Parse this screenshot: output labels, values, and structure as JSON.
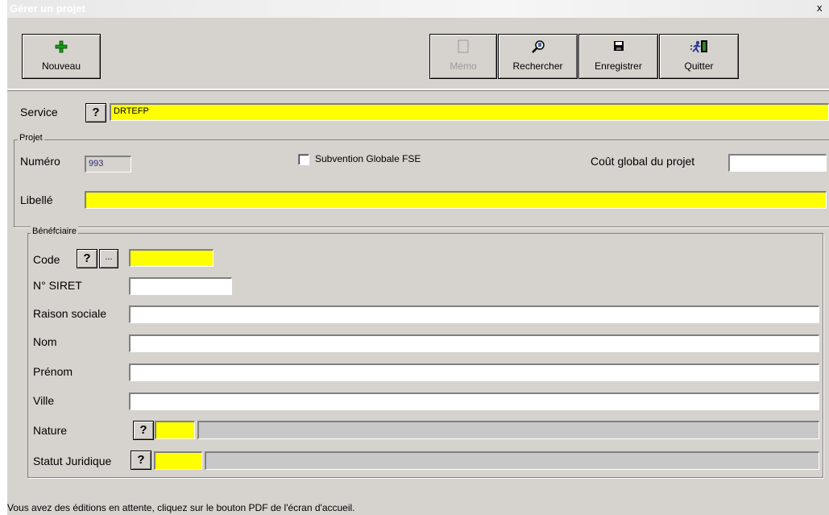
{
  "window": {
    "title": "Gérer un projet",
    "close_glyph": "x"
  },
  "toolbar": {
    "nouveau": {
      "label": "Nouveau",
      "icon": "plus-icon"
    },
    "memo": {
      "label": "Mémo",
      "icon": "memo-icon",
      "disabled": true
    },
    "rechercher": {
      "label": "Rechercher",
      "icon": "search-icon"
    },
    "enregistrer": {
      "label": "Enregistrer",
      "icon": "save-icon"
    },
    "quitter": {
      "label": "Quitter",
      "icon": "exit-icon"
    }
  },
  "service": {
    "label": "Service",
    "help": "?",
    "value": "DRTEFP"
  },
  "projet": {
    "legend": "Projet",
    "numero_label": "Numéro",
    "numero_value": "993",
    "subvention_label": "Subvention Globale FSE",
    "subvention_checked": false,
    "cout_label": "Coût global du projet",
    "cout_value": "",
    "libelle_label": "Libellé",
    "libelle_value": ""
  },
  "beneficiaire": {
    "legend": "Bénéfciaire",
    "code_label": "Code",
    "code_help": "?",
    "code_browse": "...",
    "code_value": "",
    "siret_label": "N° SIRET",
    "siret_value": "",
    "raison_label": "Raison sociale",
    "raison_value": "",
    "nom_label": "Nom",
    "nom_value": "",
    "prenom_label": "Prénom",
    "prenom_value": "",
    "ville_label": "Ville",
    "ville_value": "",
    "nature_label": "Nature",
    "nature_help": "?",
    "nature_code": "",
    "nature_desc": "",
    "statut_label": "Statut Juridique",
    "statut_help": "?",
    "statut_code": "",
    "statut_desc": ""
  },
  "status_bar": {
    "message": "Vous avez des éditions en attente, cliquez sur le bouton PDF de l'écran d'accueil."
  },
  "colors": {
    "required_field": "#ffff00",
    "window_bg": "#d6d3ce"
  }
}
